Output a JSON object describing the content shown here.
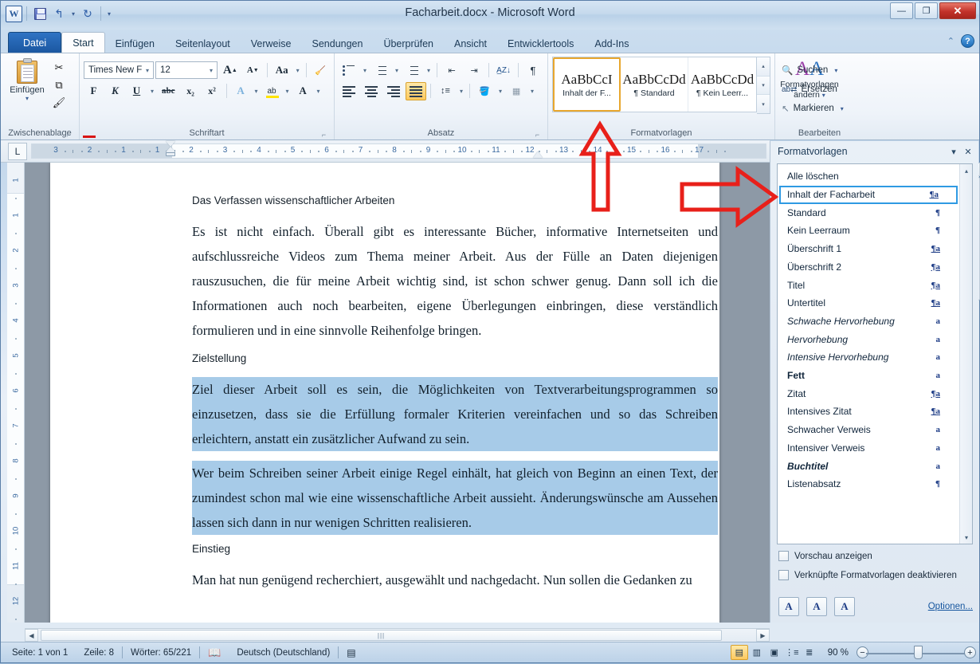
{
  "window": {
    "title": "Facharbeit.docx - Microsoft Word",
    "app_logo": "word-logo",
    "minimize": "—",
    "maximize": "❐",
    "close": "✕"
  },
  "quick_access": [
    {
      "name": "save",
      "glyph": "save-icon"
    },
    {
      "name": "undo",
      "glyph": "↰"
    },
    {
      "name": "redo",
      "glyph": "↻"
    },
    {
      "name": "customize",
      "glyph": "▾"
    }
  ],
  "tabs": [
    {
      "label": "Datei",
      "state": "file"
    },
    {
      "label": "Start",
      "state": "active"
    },
    {
      "label": "Einfügen",
      "state": "normal"
    },
    {
      "label": "Seitenlayout",
      "state": "normal"
    },
    {
      "label": "Verweise",
      "state": "normal"
    },
    {
      "label": "Sendungen",
      "state": "normal"
    },
    {
      "label": "Überprüfen",
      "state": "normal"
    },
    {
      "label": "Ansicht",
      "state": "normal"
    },
    {
      "label": "Entwicklertools",
      "state": "normal"
    },
    {
      "label": "Add-Ins",
      "state": "normal"
    }
  ],
  "help": {
    "collapse": "⌃",
    "question": "?"
  },
  "ribbon": {
    "clipboard": {
      "label": "Zwischenablage",
      "paste_label": "Einfügen",
      "paste_caret": "▾",
      "cut": "✂",
      "copy": "⧉",
      "format_painter": "🖌"
    },
    "font": {
      "label": "Schriftart",
      "font_name": "Times New F",
      "font_size": "12",
      "grow": "A",
      "shrink": "A",
      "change_case": "Aa",
      "clear_format": "Aa",
      "bold": "F",
      "italic": "K",
      "underline": "U",
      "strikethrough": "abc",
      "subscript": "x₂",
      "superscript": "x²",
      "text_effects": "A",
      "highlight": "ab",
      "font_color": "A",
      "caret": "▾"
    },
    "paragraph": {
      "label": "Absatz",
      "bullets": "bullet-list-icon",
      "numbering": "numbered-list-icon",
      "multilevel": "multilevel-list-icon",
      "decrease_indent": "◄≡",
      "increase_indent": "≡►",
      "sort": "A\nZ↓",
      "show_marks": "¶",
      "align_left": "align-left-icon",
      "align_center": "align-center-icon",
      "align_right": "align-right-icon",
      "align_justify": "align-justify-icon",
      "line_spacing": "↕≡",
      "shading": "shading-icon",
      "borders": "borders-icon",
      "caret": "▾"
    },
    "styles": {
      "label": "Formatvorlagen",
      "gallery": [
        {
          "preview": "AaBbCcI",
          "name": "Inhalt der F...",
          "selected": true
        },
        {
          "preview": "AaBbCcDd",
          "name": "¶ Standard",
          "selected": false
        },
        {
          "preview": "AaBbCcDd",
          "name": "¶ Kein Leerr...",
          "selected": false
        }
      ],
      "scroll_up": "▴",
      "scroll_down": "▾",
      "scroll_more": "▾",
      "change_styles_label": "Formatvorlagen\nändern",
      "change_styles_caret": "▾"
    },
    "editing": {
      "label": "Bearbeiten",
      "items": [
        {
          "label": "Suchen",
          "icon": "binoculars-icon",
          "caret": "▾"
        },
        {
          "label": "Ersetzen",
          "icon": "replace-icon",
          "caret": ""
        },
        {
          "label": "Markieren",
          "icon": "cursor-select-icon",
          "caret": "▾"
        }
      ]
    },
    "dialog_launcher": "⌐"
  },
  "ruler": {
    "tab_selector": "L",
    "h_numbers": [
      "3",
      "2",
      "1",
      "1",
      "2",
      "3",
      "4",
      "5",
      "6",
      "7",
      "8",
      "9",
      "10",
      "11",
      "12",
      "13",
      "14",
      "15",
      "16",
      "17"
    ],
    "v_numbers": [
      "1",
      "1",
      "2",
      "3",
      "4",
      "5",
      "6",
      "7",
      "8",
      "9",
      "10",
      "11",
      "12"
    ]
  },
  "document": {
    "heading1": "Das Verfassen wissenschaftlicher Arbeiten",
    "para1": "Es ist nicht einfach. Überall gibt es interessante Bücher, informative Internetseiten und aufschlussreiche Videos zum Thema meiner Arbeit. Aus der Fülle an Daten diejenigen rauszusuchen, die für meine Arbeit wichtig sind, ist schon schwer genug. Dann soll ich die Informationen auch noch bearbeiten, eigene Überlegungen einbringen, diese verständlich formulieren und in eine sinnvolle Reihenfolge bringen.",
    "heading2": "Zielstellung",
    "para2_selected": "Ziel dieser Arbeit soll es sein, die Möglichkeiten von Textverarbeitungsprogrammen so einzusetzen, dass sie die Erfüllung formaler Kriterien vereinfachen und so das Schreiben erleichtern, anstatt ein zusätzlicher Aufwand zu sein.",
    "para3_selected": "Wer beim Schreiben seiner Arbeit einige Regel einhält, hat gleich von Beginn an einen Text, der zumindest schon mal wie eine wissenschaftliche Arbeit aussieht. Änderungswünsche am Aussehen lassen sich dann in nur wenigen Schritten realisieren.",
    "heading3": "Einstieg",
    "para4": "Man hat nun genügend recherchiert, ausgewählt und nachgedacht. Nun sollen die Gedanken zu",
    "selection_color": "#a7cbe8"
  },
  "styles_pane": {
    "title": "Formatvorlagen",
    "minimize": "▾",
    "close": "✕",
    "items": [
      {
        "label": "Alle löschen",
        "mark": "",
        "selected": false
      },
      {
        "label": "Inhalt der Facharbeit",
        "mark": "¶a",
        "selected": true
      },
      {
        "label": "Standard",
        "mark": "¶",
        "selected": false
      },
      {
        "label": "Kein Leerraum",
        "mark": "¶",
        "selected": false
      },
      {
        "label": "Überschrift 1",
        "mark": "¶a",
        "selected": false
      },
      {
        "label": "Überschrift 2",
        "mark": "¶a",
        "selected": false
      },
      {
        "label": "Titel",
        "mark": "¶a",
        "selected": false
      },
      {
        "label": "Untertitel",
        "mark": "¶a",
        "selected": false
      },
      {
        "label": "Schwache Hervorhebung",
        "mark": "a",
        "selected": false
      },
      {
        "label": "Hervorhebung",
        "mark": "a",
        "selected": false
      },
      {
        "label": "Intensive Hervorhebung",
        "mark": "a",
        "selected": false
      },
      {
        "label": "Fett",
        "mark": "a",
        "selected": false
      },
      {
        "label": "Zitat",
        "mark": "¶a",
        "selected": false
      },
      {
        "label": "Intensives Zitat",
        "mark": "¶a",
        "selected": false
      },
      {
        "label": "Schwacher Verweis",
        "mark": "a",
        "selected": false
      },
      {
        "label": "Intensiver Verweis",
        "mark": "a",
        "selected": false
      },
      {
        "label": "Buchtitel",
        "mark": "a",
        "selected": false
      },
      {
        "label": "Listenabsatz",
        "mark": "¶",
        "selected": false
      }
    ],
    "checkbox_preview": "Vorschau anzeigen",
    "checkbox_disable_linked": "Verknüpfte Formatvorlagen deaktivieren",
    "footer_buttons": [
      {
        "name": "new-style",
        "glyph": "A"
      },
      {
        "name": "style-inspector",
        "glyph": "A"
      },
      {
        "name": "manage-styles",
        "glyph": "A"
      }
    ],
    "options_link": "Optionen...",
    "scroll_up": "▴",
    "scroll_down": "▾",
    "highlight_color": "#2f9ae3"
  },
  "status_bar": {
    "page": "Seite: 1 von 1",
    "line": "Zeile: 8",
    "words": "Wörter: 65/221",
    "proof_icon": "spellcheck-icon",
    "language": "Deutsch (Deutschland)",
    "macro_icon": "macro-icon",
    "views": [
      {
        "name": "print-layout",
        "glyph": "▤",
        "active": true
      },
      {
        "name": "full-screen-reading",
        "glyph": "📖",
        "active": false
      },
      {
        "name": "web-layout",
        "glyph": "▤",
        "active": false
      },
      {
        "name": "outline",
        "glyph": "▤",
        "active": false
      },
      {
        "name": "draft",
        "glyph": "▤",
        "active": false
      }
    ],
    "zoom_value": "90 %",
    "zoom_out": "−",
    "zoom_in": "+"
  },
  "annotations": {
    "arrow_color": "#e8201a",
    "up_arrow_target": "styles-gallery-first-item",
    "right_arrow_target": "styles-pane-inhalt-der-facharbeit"
  }
}
